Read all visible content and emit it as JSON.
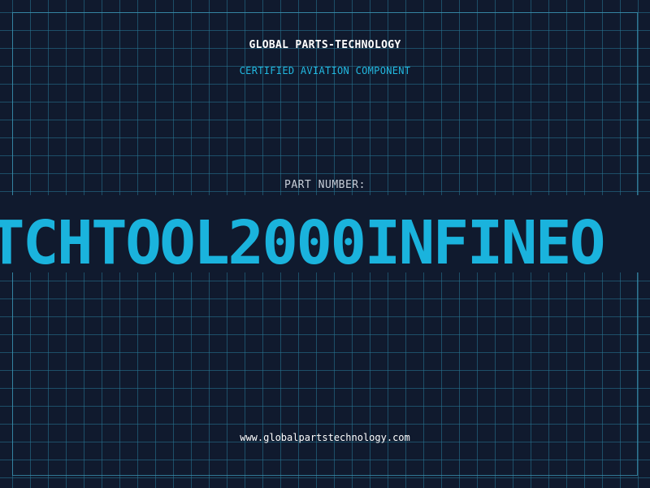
{
  "label": {
    "company": "GLOBAL PARTS-TECHNOLOGY",
    "subtitle": "CERTIFIED AVIATION COMPONENT",
    "part_number_label": "PART NUMBER:",
    "part_number": "TCHTOOL2000INFINEO",
    "website": "www.globalpartstechnology.com"
  },
  "colors": {
    "background": "#101a2e",
    "grid": "#28789a",
    "accent": "#1ab3dd",
    "text": "#ffffff"
  }
}
